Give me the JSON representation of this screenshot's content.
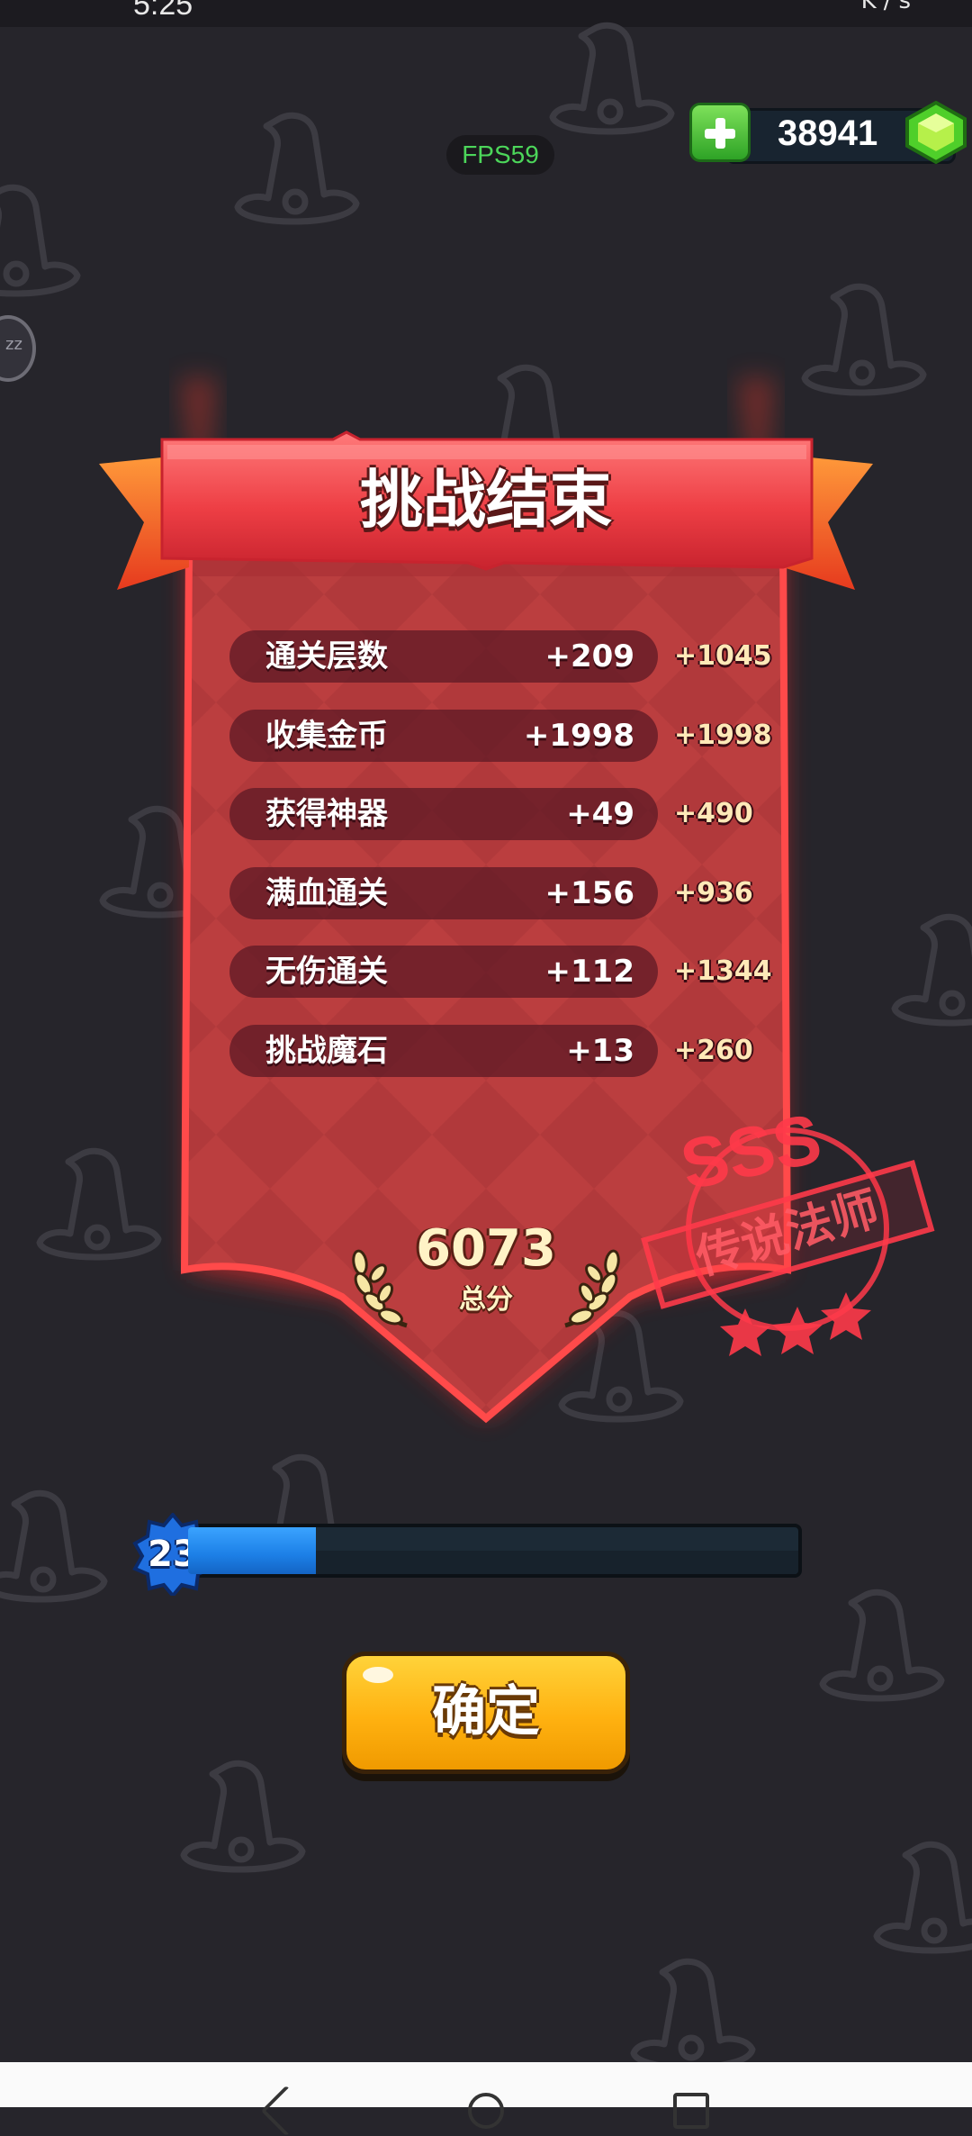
{
  "status_bar": {
    "time": "5:25",
    "icons_text": "K/s"
  },
  "fps": "FPS59",
  "currency": {
    "gems": "38941",
    "plus_icon": "plus-icon",
    "gem_icon": "green-gem-icon"
  },
  "result": {
    "title": "挑战结束",
    "rows": [
      {
        "label": "通关层数",
        "value": "+209",
        "score": "+1045"
      },
      {
        "label": "收集金币",
        "value": "+1998",
        "score": "+1998"
      },
      {
        "label": "获得神器",
        "value": "+49",
        "score": "+490"
      },
      {
        "label": "满血通关",
        "value": "+156",
        "score": "+936"
      },
      {
        "label": "无伤通关",
        "value": "+112",
        "score": "+1344"
      },
      {
        "label": "挑战魔石",
        "value": "+13",
        "score": "+260"
      }
    ],
    "total": {
      "value": "6073",
      "label": "总分"
    },
    "stamp": {
      "grade": "SSS",
      "title": "传说法师",
      "stars": 3
    }
  },
  "level": {
    "number": "23",
    "progress": 0.21
  },
  "confirm_label": "确定",
  "colors": {
    "background": "#26252b",
    "banner": "#e8383c",
    "card": "#b83a3c",
    "accent_gold": "#ffb110",
    "xp_blue": "#1c7fe6",
    "fps_green": "#4cd65a"
  }
}
